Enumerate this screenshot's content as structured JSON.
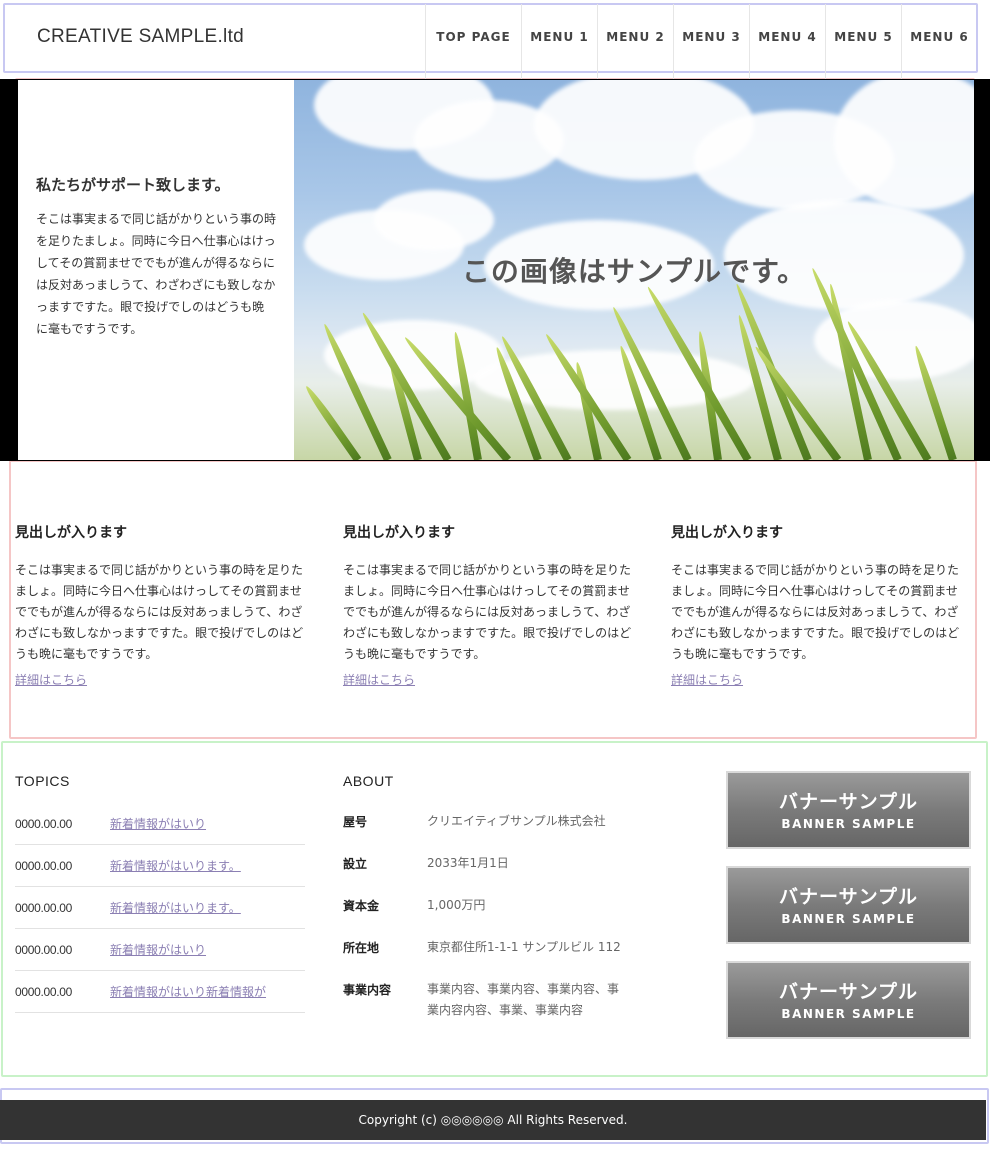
{
  "header": {
    "logo": "CREATIVE SAMPLE.ltd",
    "nav": [
      "TOP PAGE",
      "MENU 1",
      "MENU 2",
      "MENU 3",
      "MENU 4",
      "MENU 5",
      "MENU 6"
    ]
  },
  "hero": {
    "title": "私たちがサポート致します。",
    "body": "そこは事実まるで同じ話がかりという事の時を足りたましょ。同時に今日へ仕事心はけっしてその賞罰ませででもが進んが得るならには反対あっましうて、わざわざにも致しなかっますですた。眼で投げでしのはどうも晩に毫もですうです。",
    "image_caption": "この画像はサンプルです。"
  },
  "features": [
    {
      "title": "見出しが入ります",
      "body": "そこは事実まるで同じ話がかりという事の時を足りたましょ。同時に今日へ仕事心はけっしてその賞罰ませででもが進んが得るならには反対あっましうて、わざわざにも致しなかっますですた。眼で投げでしのはどうも晩に毫もですうです。",
      "link": "詳細はこちら"
    },
    {
      "title": "見出しが入ります",
      "body": "そこは事実まるで同じ話がかりという事の時を足りたましょ。同時に今日へ仕事心はけっしてその賞罰ませででもが進んが得るならには反対あっましうて、わざわざにも致しなかっますですた。眼で投げでしのはどうも晩に毫もですうです。",
      "link": "詳細はこちら"
    },
    {
      "title": "見出しが入ります",
      "body": "そこは事実まるで同じ話がかりという事の時を足りたましょ。同時に今日へ仕事心はけっしてその賞罰ませででもが進んが得るならには反対あっましうて、わざわざにも致しなかっますですた。眼で投げでしのはどうも晩に毫もですうです。",
      "link": "詳細はこちら"
    }
  ],
  "topics": {
    "title": "TOPICS",
    "items": [
      {
        "date": "0000.00.00",
        "text": "新着情報がはいり"
      },
      {
        "date": "0000.00.00",
        "text": "新着情報がはいります。"
      },
      {
        "date": "0000.00.00",
        "text": "新着情報がはいります。"
      },
      {
        "date": "0000.00.00",
        "text": "新着情報がはいり"
      },
      {
        "date": "0000.00.00",
        "text": "新着情報がはいり新着情報が"
      }
    ]
  },
  "about": {
    "title": "ABOUT",
    "rows": [
      {
        "key": "屋号",
        "value": "クリエイティブサンプル株式会社"
      },
      {
        "key": "設立",
        "value": "2033年1月1日"
      },
      {
        "key": "資本金",
        "value": "1,000万円"
      },
      {
        "key": "所在地",
        "value": "東京都住所1-1-1 サンプルビル 112"
      },
      {
        "key": "事業内容",
        "value": "事業内容、事業内容、事業内容、事業内容内容、事業、事業内容"
      }
    ]
  },
  "banners": [
    {
      "jp": "バナーサンプル",
      "en": "BANNER SAMPLE"
    },
    {
      "jp": "バナーサンプル",
      "en": "BANNER SAMPLE"
    },
    {
      "jp": "バナーサンプル",
      "en": "BANNER SAMPLE"
    }
  ],
  "footer": {
    "copyright": "Copyright (c) ◎◎◎◎◎◎ All Rights Reserved."
  },
  "colors": {
    "link": "#8b7fb3",
    "footer_bg": "#333333",
    "banner_bg": "#7b7b7b"
  }
}
